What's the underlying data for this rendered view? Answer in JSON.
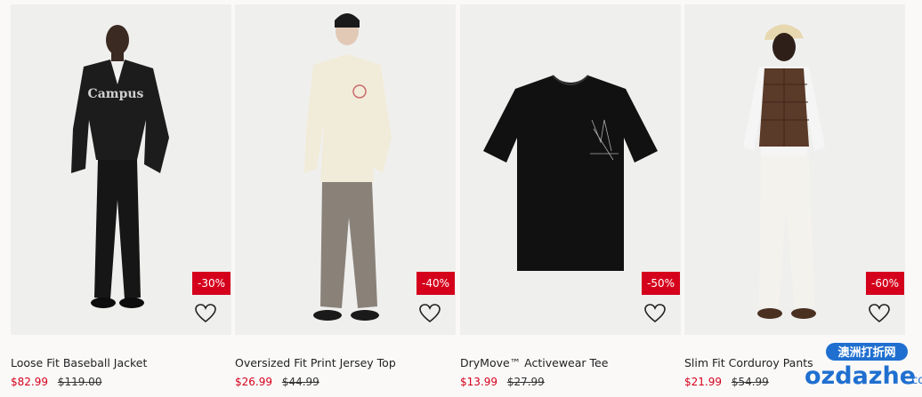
{
  "products": [
    {
      "name": "Loose Fit Baseball Jacket",
      "sale_price": "$82.99",
      "original_price": "$119.00",
      "discount": "-30%"
    },
    {
      "name": "Oversized Fit Print Jersey Top",
      "sale_price": "$26.99",
      "original_price": "$44.99",
      "discount": "-40%"
    },
    {
      "name": "DryMove™ Activewear Tee",
      "sale_price": "$13.99",
      "original_price": "$27.99",
      "discount": "-50%"
    },
    {
      "name": "Slim Fit Corduroy Pants",
      "sale_price": "$21.99",
      "original_price": "$54.99",
      "discount": "-60%"
    }
  ],
  "watermark": {
    "top_text": "澳洲打折网",
    "brand": "ozdazhe",
    "suffix": ".com"
  },
  "colors": {
    "sale_red": "#d5001c",
    "badge_bg": "#d5001c",
    "watermark_blue": "#1f6fd0"
  }
}
